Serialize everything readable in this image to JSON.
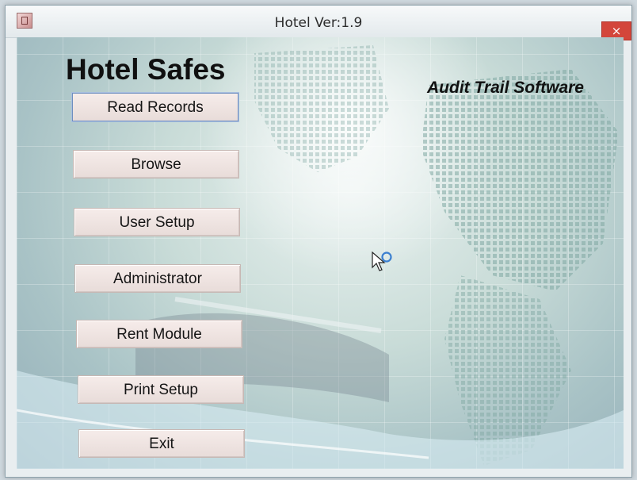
{
  "window": {
    "title": "Hotel Ver:1.9",
    "close_label": "×"
  },
  "header": {
    "app_title": "Hotel Safes",
    "tagline": "Audit Trail Software"
  },
  "menu": {
    "read_records": "Read Records",
    "browse": "Browse",
    "user_setup": "User Setup",
    "administrator": "Administrator",
    "rent_module": "Rent Module",
    "print_setup": "Print Setup",
    "exit": "Exit"
  },
  "colors": {
    "close_button": "#d3463b",
    "background_teal": "#a9c3c6",
    "button_face": "#f6ecea"
  },
  "icons": {
    "app": "safe-icon",
    "cursor": "busy-pointer-icon"
  }
}
